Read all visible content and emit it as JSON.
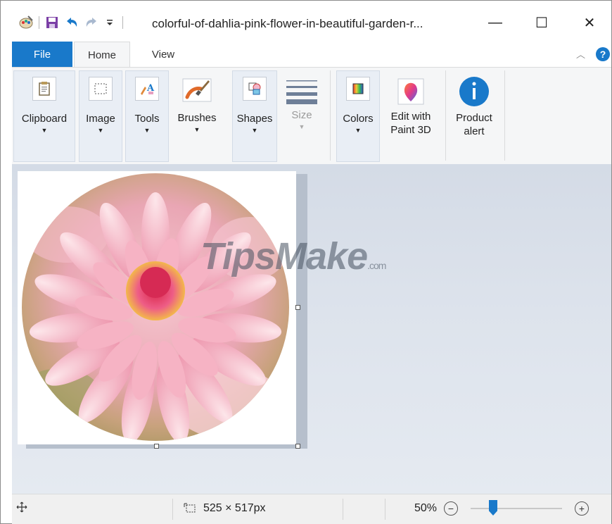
{
  "window": {
    "title": "colorful-of-dahlia-pink-flower-in-beautiful-garden-r...",
    "controls": {
      "minimize": "—",
      "maximize": "☐",
      "close": "✕"
    }
  },
  "quick_access": [
    "paint-app-icon",
    "save-icon",
    "undo-icon",
    "redo-icon",
    "customize-qat-icon"
  ],
  "tabs": {
    "file": "File",
    "home": "Home",
    "view": "View"
  },
  "ribbon": {
    "clipboard": "Clipboard",
    "image": "Image",
    "tools": "Tools",
    "brushes": "Brushes",
    "shapes": "Shapes",
    "size": "Size",
    "colors": "Colors",
    "edit_paint3d": "Edit with\nPaint 3D",
    "product_alert": "Product\nalert"
  },
  "canvas": {
    "watermark": "TipsMake",
    "watermark_suffix": ".com"
  },
  "status": {
    "selection_size": "525 × 517px",
    "zoom": "50%",
    "zoom_level": 0.5
  },
  "colors": {
    "accent": "#1979ca",
    "help_icon": "#1979ca"
  }
}
